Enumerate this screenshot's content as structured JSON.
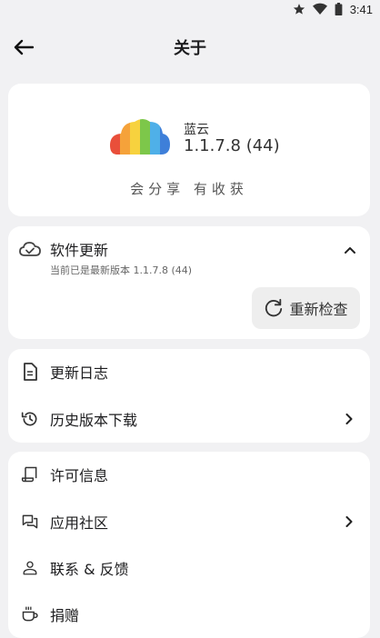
{
  "status_bar": {
    "time": "3:41",
    "icons": [
      "star-icon",
      "wifi-icon",
      "battery-icon"
    ]
  },
  "header": {
    "title": "关于"
  },
  "about": {
    "app_name": "蓝云",
    "version": "1.1.7.8 (44)",
    "slogan": "会分享 有收获"
  },
  "update": {
    "title": "软件更新",
    "subtitle": "当前已是最新版本 1.1.7.8 (44)",
    "recheck_label": "重新检查"
  },
  "links": {
    "changelog": "更新日志",
    "history_download": "历史版本下载"
  },
  "misc": {
    "license": "许可信息",
    "community": "应用社区",
    "contact": "联系 & 反馈",
    "donate": "捐赠"
  },
  "colors": {
    "background": "#f1f1f3",
    "card": "#ffffff",
    "text": "#1d1d1f"
  }
}
